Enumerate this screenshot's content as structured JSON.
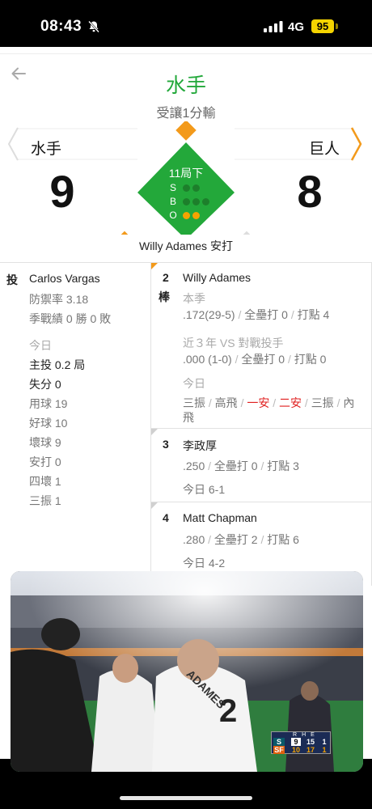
{
  "status": {
    "time": "08:43",
    "network": "4G",
    "battery": "95"
  },
  "header": {
    "winner": "水手",
    "subtitle": "受讓1分輸"
  },
  "teams": {
    "away": {
      "name": "水手",
      "score": "9"
    },
    "home": {
      "name": "巨人",
      "score": "8"
    }
  },
  "game_state": {
    "inning": "11局下",
    "labels": [
      "S",
      "B",
      "O"
    ],
    "strikes": 0,
    "balls": 0,
    "outs": 2
  },
  "last_play": "Willy Adames 安打",
  "pitcher": {
    "role_label": "投",
    "name": "Carlos Vargas",
    "era": "防禦率 3.18",
    "record": "季戰績 0 勝 0 敗",
    "today_label": "今日",
    "ip": "主投 0.2 局",
    "runs": "失分 0",
    "pitches": "用球 19",
    "strikes": "好球 10",
    "balls": "壞球 9",
    "hits": "安打 0",
    "walks": "四壞 1",
    "ks": "三振 1"
  },
  "batters": [
    {
      "order": "2",
      "order_suffix": "棒",
      "name": "Willy Adames",
      "season_label": "本季",
      "season_avg": ".172(29-5)",
      "season_hr": "全壘打 0",
      "season_rbi": "打點 4",
      "vs_label": "近３年 VS 對戰投手",
      "vs_avg": ".000 (1-0)",
      "vs_hr": "全壘打 0",
      "vs_rbi": "打點 0",
      "today_label": "今日",
      "today_results": [
        "三振",
        "高飛",
        "一安",
        "二安",
        "三振",
        "內"
      ],
      "today_wrap": "飛"
    },
    {
      "order": "3",
      "name": "李政厚",
      "avg": ".250",
      "hr": "全壘打 0",
      "rbi": "打點 3",
      "today": "今日 6-1"
    },
    {
      "order": "4",
      "name": "Matt Chapman",
      "avg": ".280",
      "hr": "全壘打 2",
      "rbi": "打點 6",
      "today": "今日 4-2"
    }
  ],
  "video": {
    "scorebug": {
      "header": [
        "R",
        "H",
        "E"
      ],
      "rows": [
        {
          "team": "S",
          "r": "9",
          "h": "15",
          "e": "1"
        },
        {
          "team": "SF",
          "r": "10",
          "h": "17",
          "e": "1"
        }
      ]
    },
    "jersey_number": "2",
    "jersey_text": "ADAMES"
  },
  "colors": {
    "green": "#22a83a",
    "orange": "#f39a1b",
    "accent_red": "#e02020"
  }
}
